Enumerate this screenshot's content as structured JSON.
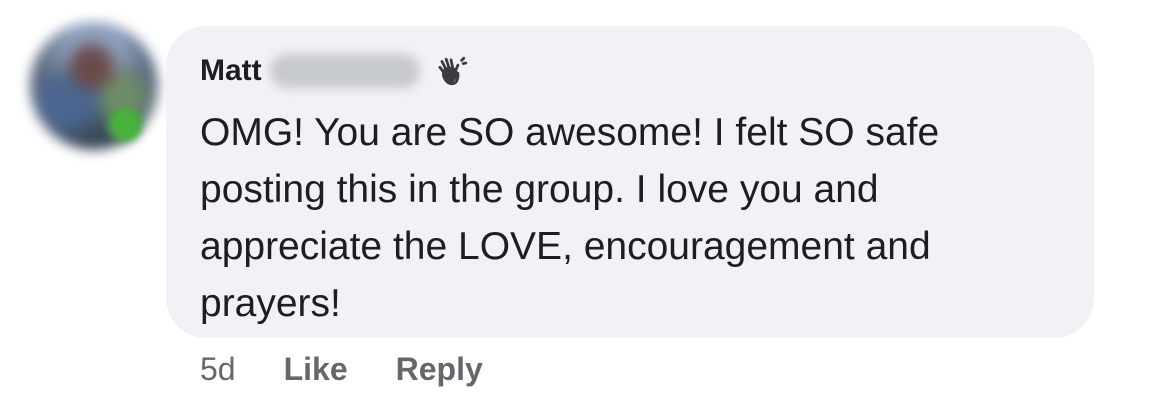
{
  "comment": {
    "author_name": "Matt",
    "badge_icon": "waving-hand-icon",
    "message": "OMG! You are SO awesome! I felt SO safe\nposting this in the group. I  love you and\nappreciate the LOVE, encouragement and\nprayers!",
    "bubble_color": "#f0f2f5"
  },
  "actions": {
    "timestamp": "5d",
    "like_label": "Like",
    "reply_label": "Reply"
  }
}
